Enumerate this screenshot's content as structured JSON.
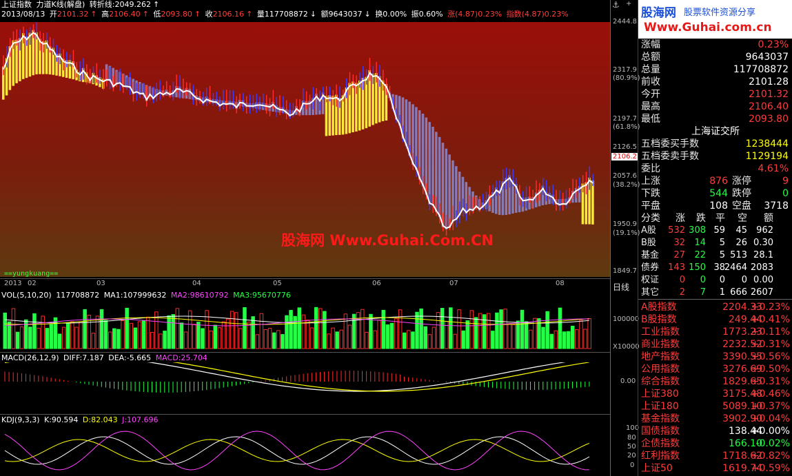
{
  "header": {
    "index_name": "上证指数",
    "indicator": "力道K线(解盘)",
    "trend_label": "转折线:",
    "trend_value": "2049.262",
    "date": "2013/08/13",
    "open_lbl": "开",
    "open": "2101.32",
    "high_lbl": "高",
    "high": "2106.40",
    "low_lbl": "低",
    "low": "2093.80",
    "close_lbl": "收",
    "close": "2106.16",
    "vol_lbl": "量",
    "vol": "117708872",
    "amt_lbl": "额",
    "amt": "9643037",
    "turn_lbl": "换",
    "turn": "0.00%",
    "amp_lbl": "振",
    "amp": "0.60%",
    "rise_lbl": "涨(4.87)",
    "rise": "0.23%",
    "idx_lbl": "指数(4.87)",
    "idx": "0.23%"
  },
  "watermark": "股海网 Www.Guhai.Com.CN",
  "logo": {
    "line1": "股海网",
    "line1b": "股票软件资源分享",
    "line2": "Www.Guhai.com.cn"
  },
  "main_axis": {
    "labels": [
      "2444.8",
      "2317.9",
      "(80.9%)",
      "2197.7",
      "(61.8%)",
      "2126.5",
      "2106.2",
      "2057.6",
      "(38.2%)",
      "1950.9",
      "(19.1%)",
      "1849.7"
    ]
  },
  "yungkuang": "==yungkuang==",
  "time_axis": {
    "labels": [
      "2013",
      "02",
      "03",
      "04",
      "05",
      "06",
      "07",
      "08"
    ],
    "period": "日线"
  },
  "vol_panel": {
    "title": "VOL(5,10,20)",
    "vol": "117708872",
    "ma1": "MA1:107999632",
    "ma2": "MA2:98610792",
    "ma3": "MA3:95670776",
    "axis": [
      "100000",
      "X10000"
    ]
  },
  "macd_panel": {
    "title": "MACD(26,12,9)",
    "diff": "DIFF:7.187",
    "dea": "DEA:-5.665",
    "macd": "MACD:25.704",
    "axis": [
      "0.00"
    ]
  },
  "kdj_panel": {
    "title": "KDJ(9,3,3)",
    "k": "K:90.594",
    "d": "D:82.043",
    "j": "J:107.696",
    "axis": [
      "100",
      "80",
      "50",
      "20",
      "0"
    ]
  },
  "quote": {
    "rows": [
      {
        "label": "涨幅",
        "value": "0.23%",
        "color": "red"
      },
      {
        "label": "总额",
        "value": "9643037",
        "color": "white"
      },
      {
        "label": "总量",
        "value": "117708872",
        "color": "white"
      },
      {
        "label": "前收",
        "value": "2101.28",
        "color": "white"
      },
      {
        "label": "今开",
        "value": "2101.32",
        "color": "red"
      },
      {
        "label": "最高",
        "value": "2106.40",
        "color": "red"
      },
      {
        "label": "最低",
        "value": "2093.80",
        "color": "red"
      }
    ],
    "exchange": "上海证交所",
    "orders": [
      {
        "label": "五档委买手数",
        "value": "1238444",
        "color": "yellow"
      },
      {
        "label": "五档委卖手数",
        "value": "1129194",
        "color": "yellow"
      },
      {
        "label": "委比",
        "value": "4.61%",
        "color": "red"
      }
    ],
    "breadth": [
      {
        "l1": "上涨",
        "v1": "876",
        "c1": "red",
        "l2": "涨停",
        "v2": "9",
        "c2": "red"
      },
      {
        "l1": "下跌",
        "v1": "544",
        "c1": "green",
        "l2": "跌停",
        "v2": "0",
        "c2": "green"
      },
      {
        "l1": "平盘",
        "v1": "108",
        "c1": "white",
        "l2": "空盘",
        "v2": "3718",
        "c2": "white"
      }
    ]
  },
  "category_table": {
    "headers": [
      "分类",
      "涨",
      "跌",
      "平",
      "空",
      "额"
    ],
    "rows": [
      [
        "A股",
        "532",
        "308",
        "59",
        "45",
        "962"
      ],
      [
        "B股",
        "32",
        "14",
        "5",
        "26",
        "0.30"
      ],
      [
        "基金",
        "27",
        "22",
        "5",
        "513",
        "28.1"
      ],
      [
        "债券",
        "143",
        "150",
        "38",
        "2464",
        "2083"
      ],
      [
        "权证",
        "0",
        "0",
        "0",
        "0",
        "0.00"
      ],
      [
        "其它",
        "2",
        "7",
        "1",
        "666",
        "2607"
      ]
    ]
  },
  "indices": [
    {
      "name": "A股指数",
      "point": "2204.33",
      "pct": "+0.23%",
      "color": "red"
    },
    {
      "name": "B股指数",
      "point": "249.44",
      "pct": "+0.41%",
      "color": "red"
    },
    {
      "name": "工业指数",
      "point": "1773.23",
      "pct": "+0.11%",
      "color": "red"
    },
    {
      "name": "商业指数",
      "point": "2232.52",
      "pct": "+0.31%",
      "color": "red"
    },
    {
      "name": "地产指数",
      "point": "3390.55",
      "pct": "+0.56%",
      "color": "red"
    },
    {
      "name": "公用指数",
      "point": "3276.69",
      "pct": "+0.50%",
      "color": "red"
    },
    {
      "name": "综合指数",
      "point": "1829.65",
      "pct": "+0.31%",
      "color": "red"
    },
    {
      "name": "上证380",
      "point": "3175.48",
      "pct": "+0.46%",
      "color": "red"
    },
    {
      "name": "上证180",
      "point": "5089.10",
      "pct": "+0.37%",
      "color": "red"
    },
    {
      "name": "基金指数",
      "point": "3902.90",
      "pct": "+0.04%",
      "color": "red"
    },
    {
      "name": "国债指数",
      "point": "138.44",
      "pct": "+0.00%",
      "color": "white"
    },
    {
      "name": "企债指数",
      "point": "166.10",
      "pct": "-0.02%",
      "color": "green"
    },
    {
      "name": "红利指数",
      "point": "1718.62",
      "pct": "+0.82%",
      "color": "red"
    },
    {
      "name": "上证50",
      "point": "1619.74",
      "pct": "+0.59%",
      "color": "red"
    }
  ],
  "colors": {
    "panel_bg": "#8b0f0a",
    "up": "#ff2a2a",
    "down": "#3b3bff",
    "yellow": "#ffff00",
    "green": "#22ff44",
    "white": "#ffffff"
  }
}
